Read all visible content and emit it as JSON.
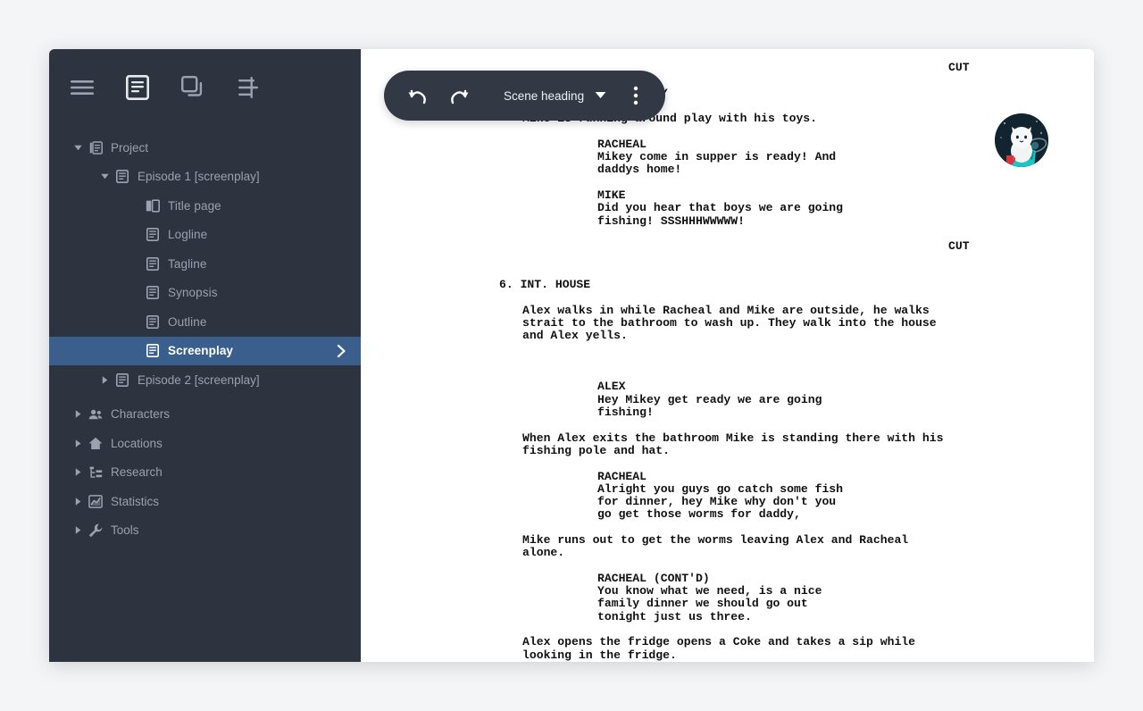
{
  "window": {
    "background": "#f4f5f6",
    "sidebar_bg": "#2d3440",
    "accent": "#3b5f8d"
  },
  "sidebar": {
    "toolbar": [
      {
        "name": "menu-icon",
        "label": "Menu",
        "active": false
      },
      {
        "name": "document-icon",
        "label": "Document",
        "active": true
      },
      {
        "name": "cards-icon",
        "label": "Cards",
        "active": false
      },
      {
        "name": "outline-tune-icon",
        "label": "Outline",
        "active": false
      }
    ],
    "tree": [
      {
        "label": "Project",
        "level": 0,
        "icon": "project-icon",
        "caret": "down",
        "selected": false
      },
      {
        "label": "Episode 1 [screenplay]",
        "level": 1,
        "icon": "document-icon",
        "caret": "down",
        "selected": false
      },
      {
        "label": "Title page",
        "level": 2,
        "icon": "title-page-icon",
        "caret": "none",
        "selected": false
      },
      {
        "label": "Logline",
        "level": 2,
        "icon": "document-icon",
        "caret": "none",
        "selected": false
      },
      {
        "label": "Tagline",
        "level": 2,
        "icon": "document-icon",
        "caret": "none",
        "selected": false
      },
      {
        "label": "Synopsis",
        "level": 2,
        "icon": "document-icon",
        "caret": "none",
        "selected": false
      },
      {
        "label": "Outline",
        "level": 2,
        "icon": "document-icon",
        "caret": "none",
        "selected": false
      },
      {
        "label": "Screenplay",
        "level": 2,
        "icon": "document-icon",
        "caret": "none",
        "selected": true
      },
      {
        "label": "Episode 2 [screenplay]",
        "level": 1,
        "icon": "document-icon",
        "caret": "right",
        "selected": false
      },
      {
        "label": "Characters",
        "level": 0,
        "icon": "people-icon",
        "caret": "right",
        "selected": false
      },
      {
        "label": "Locations",
        "level": 0,
        "icon": "home-icon",
        "caret": "right",
        "selected": false
      },
      {
        "label": "Research",
        "level": 0,
        "icon": "tree-icon",
        "caret": "right",
        "selected": false
      },
      {
        "label": "Statistics",
        "level": 0,
        "icon": "chart-icon",
        "caret": "right",
        "selected": false
      },
      {
        "label": "Tools",
        "level": 0,
        "icon": "wrench-icon",
        "caret": "right",
        "selected": false
      }
    ]
  },
  "editor_toolbar": {
    "undo_label": "Undo",
    "redo_label": "Redo",
    "format_selected": "Scene heading",
    "more_label": "More options"
  },
  "avatar": {
    "alt": "User avatar - white cat with laptop and red mug"
  },
  "script": {
    "lines": [
      {
        "type": "transition",
        "text": "CUT"
      },
      {
        "type": "blank"
      },
      {
        "type": "heading-r",
        "text": "DAY"
      },
      {
        "type": "blank"
      },
      {
        "type": "action",
        "text": "Mike is running around play with his toys."
      },
      {
        "type": "blank"
      },
      {
        "type": "char",
        "text": "RACHEAL"
      },
      {
        "type": "dialog",
        "text": "Mikey come in supper is ready! And"
      },
      {
        "type": "dialog",
        "text": "daddys home!"
      },
      {
        "type": "blank"
      },
      {
        "type": "char",
        "text": "MIKE"
      },
      {
        "type": "dialog",
        "text": "Did you hear that boys we are going"
      },
      {
        "type": "dialog",
        "text": "fishing! SSSHHHWWWWW!"
      },
      {
        "type": "blank"
      },
      {
        "type": "transition",
        "text": "CUT"
      },
      {
        "type": "blank"
      },
      {
        "type": "blank"
      },
      {
        "type": "heading",
        "text": "6. INT. HOUSE"
      },
      {
        "type": "blank"
      },
      {
        "type": "action",
        "text": "Alex walks in while Racheal and Mike are outside, he walks"
      },
      {
        "type": "action",
        "text": "strait to the bathroom to wash up. They walk into the house"
      },
      {
        "type": "action",
        "text": "and Alex yells."
      },
      {
        "type": "blank"
      },
      {
        "type": "blank"
      },
      {
        "type": "blank"
      },
      {
        "type": "char",
        "text": "ALEX"
      },
      {
        "type": "dialog",
        "text": "Hey Mikey get ready we are going"
      },
      {
        "type": "dialog",
        "text": "fishing!"
      },
      {
        "type": "blank"
      },
      {
        "type": "action",
        "text": "When Alex exits the bathroom Mike is standing there with his"
      },
      {
        "type": "action",
        "text": "fishing pole and hat."
      },
      {
        "type": "blank"
      },
      {
        "type": "char",
        "text": "RACHEAL"
      },
      {
        "type": "dialog",
        "text": "Alright you guys go catch some fish"
      },
      {
        "type": "dialog",
        "text": "for dinner, hey Mike why don't you"
      },
      {
        "type": "dialog",
        "text": "go get those worms for daddy,"
      },
      {
        "type": "blank"
      },
      {
        "type": "action",
        "text": "Mike runs out to get the worms leaving Alex and Racheal"
      },
      {
        "type": "action",
        "text": "alone."
      },
      {
        "type": "blank"
      },
      {
        "type": "char",
        "text": "RACHEAL (CONT'D)"
      },
      {
        "type": "dialog",
        "text": "You know what we need, is a nice"
      },
      {
        "type": "dialog",
        "text": "family dinner we should go out"
      },
      {
        "type": "dialog",
        "text": "tonight just us three."
      },
      {
        "type": "blank"
      },
      {
        "type": "action",
        "text": "Alex opens the fridge opens a Coke and takes a sip while"
      },
      {
        "type": "action",
        "text": "looking in the fridge."
      }
    ]
  }
}
